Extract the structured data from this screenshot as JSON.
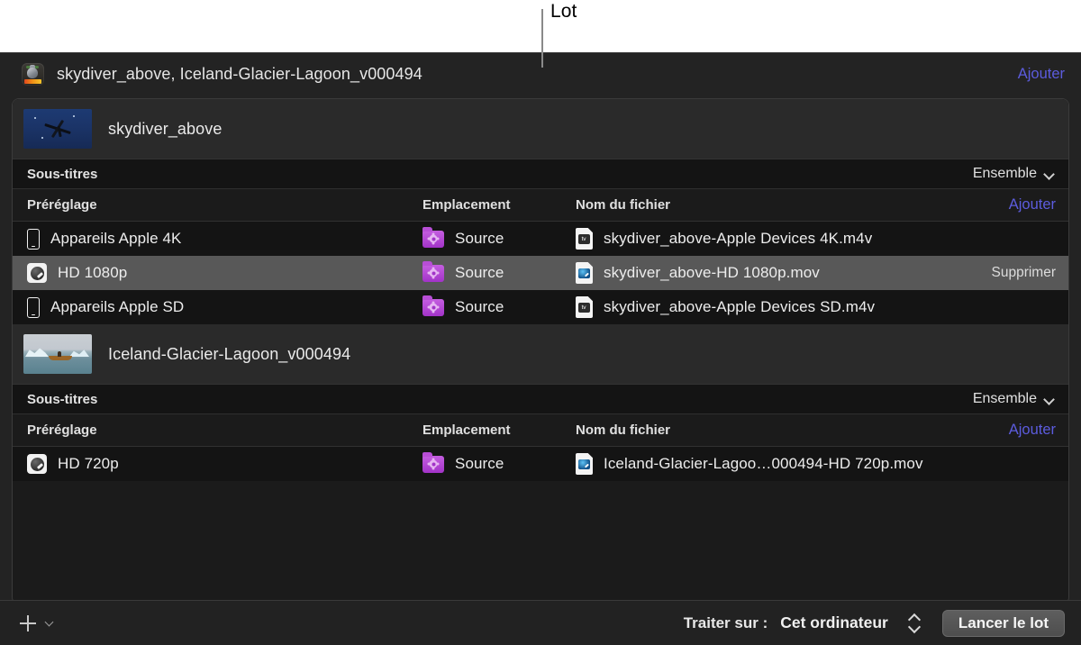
{
  "callout": {
    "label": "Lot"
  },
  "window": {
    "titlebar": {
      "app_icon": "compressor-app-icon",
      "title": "skydiver_above, Iceland-Glacier-Lagoon_v000494",
      "add_label": "Ajouter",
      "add_link_color": "#5c5cde"
    },
    "jobs": [
      {
        "thumbnail": "skydiver-thumbnail",
        "name": "skydiver_above",
        "subtitles": {
          "label": "Sous-titres",
          "popup_value": "Ensemble",
          "popup_icon": "chevron-down-icon"
        },
        "columns": {
          "preset": "Préréglage",
          "location": "Emplacement",
          "filename": "Nom du fichier",
          "add_label": "Ajouter"
        },
        "outputs": [
          {
            "preset_icon": "iphone-icon",
            "preset": "Appareils Apple 4K",
            "location_icon": "purple-folder-icon",
            "location": "Source",
            "file_icon": "m4v-document-icon",
            "filename": "skydiver_above-Apple Devices 4K.m4v",
            "selected": false,
            "delete_label": ""
          },
          {
            "preset_icon": "quicktime-icon",
            "preset": "HD 1080p",
            "location_icon": "purple-folder-icon",
            "location": "Source",
            "file_icon": "mov-document-icon",
            "filename": "skydiver_above-HD 1080p.mov",
            "selected": true,
            "delete_label": "Supprimer"
          },
          {
            "preset_icon": "iphone-icon",
            "preset": "Appareils Apple SD",
            "location_icon": "purple-folder-icon",
            "location": "Source",
            "file_icon": "m4v-document-icon",
            "filename": "skydiver_above-Apple Devices SD.m4v",
            "selected": false,
            "delete_label": ""
          }
        ]
      },
      {
        "thumbnail": "glacier-lagoon-thumbnail",
        "name": "Iceland-Glacier-Lagoon_v000494",
        "subtitles": {
          "label": "Sous-titres",
          "popup_value": "Ensemble",
          "popup_icon": "chevron-down-icon"
        },
        "columns": {
          "preset": "Préréglage",
          "location": "Emplacement",
          "filename": "Nom du fichier",
          "add_label": "Ajouter"
        },
        "outputs": [
          {
            "preset_icon": "quicktime-icon",
            "preset": "HD 720p",
            "location_icon": "purple-folder-icon",
            "location": "Source",
            "file_icon": "mov-document-icon",
            "filename": "Iceland-Glacier-Lagoo…000494-HD 720p.mov",
            "selected": false,
            "delete_label": ""
          }
        ]
      }
    ],
    "toolbar": {
      "add_icon": "plus-icon",
      "add_menu_icon": "chevron-down-icon",
      "process_label": "Traiter sur :",
      "process_value": "Cet ordinateur",
      "process_stepper_icon": "up-down-stepper-icon",
      "start_button": "Lancer le lot"
    }
  },
  "colors": {
    "accent_link": "#5c5cde",
    "selected_row": "#585858",
    "window_bg": "#232323",
    "list_bg": "#141414"
  }
}
